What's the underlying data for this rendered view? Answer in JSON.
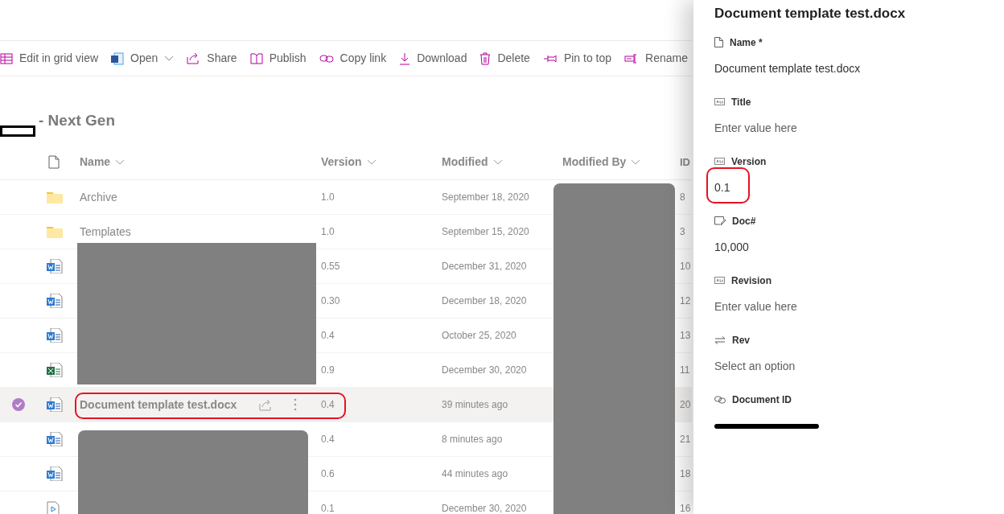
{
  "toolbar": [
    {
      "kind": "grid",
      "label": "Edit in grid view"
    },
    {
      "kind": "word",
      "label": "Open",
      "dropdown": true
    },
    {
      "kind": "share",
      "label": "Share"
    },
    {
      "kind": "book",
      "label": "Publish"
    },
    {
      "kind": "link",
      "label": "Copy link"
    },
    {
      "kind": "download",
      "label": "Download"
    },
    {
      "kind": "trash",
      "label": "Delete"
    },
    {
      "kind": "pin",
      "label": "Pin to top"
    },
    {
      "kind": "rename",
      "label": "Rename"
    }
  ],
  "library_title": "- Next Gen",
  "columns": [
    {
      "label": "Name"
    },
    {
      "label": "Version"
    },
    {
      "label": "Modified"
    },
    {
      "label": "Modified By"
    },
    {
      "label": "ID"
    }
  ],
  "rows": [
    {
      "kind": "folder",
      "name": "Archive",
      "version": "1.0",
      "modified": "September 18, 2020",
      "id": "8",
      "selected": false
    },
    {
      "kind": "folder",
      "name": "Templates",
      "version": "1.0",
      "modified": "September 15, 2020",
      "id": "3",
      "selected": false
    },
    {
      "kind": "word",
      "version": "0.55",
      "modified": "December 31, 2020",
      "id": "10",
      "selected": false
    },
    {
      "kind": "word",
      "version": "0.30",
      "modified": "December 18, 2020",
      "id": "12",
      "selected": false
    },
    {
      "kind": "word",
      "version": "0.4",
      "modified": "October 25, 2020",
      "id": "13",
      "selected": false
    },
    {
      "kind": "excel",
      "version": "0.9",
      "modified": "December 30, 2020",
      "id": "11",
      "selected": false
    },
    {
      "kind": "word",
      "name": "Document template test.docx",
      "version": "0.4",
      "modified": "39 minutes ago",
      "id": "20",
      "selected": true
    },
    {
      "kind": "word",
      "version": "0.4",
      "modified": "8 minutes ago",
      "id": "21",
      "selected": false
    },
    {
      "kind": "word",
      "version": "0.6",
      "modified": "44 minutes ago",
      "id": "18",
      "selected": false
    },
    {
      "kind": "video",
      "version": "0.1",
      "modified": "December 30, 2020",
      "id": "16",
      "selected": false
    }
  ],
  "panel": {
    "title": "Document template test.docx",
    "fields": [
      {
        "kind": "file",
        "label": "Name *",
        "value": "Document template test.docx"
      },
      {
        "kind": "text",
        "label": "Title",
        "placeholder": "Enter value here"
      },
      {
        "kind": "text",
        "label": "Version",
        "value": "0.1"
      },
      {
        "kind": "edit",
        "label": "Doc#",
        "value": "10,000"
      },
      {
        "kind": "text",
        "label": "Revision",
        "placeholder": "Enter value here"
      },
      {
        "kind": "swap",
        "label": "Rev",
        "placeholder": "Select an option"
      },
      {
        "kind": "link",
        "label": "Document ID",
        "redacted": true
      }
    ]
  }
}
